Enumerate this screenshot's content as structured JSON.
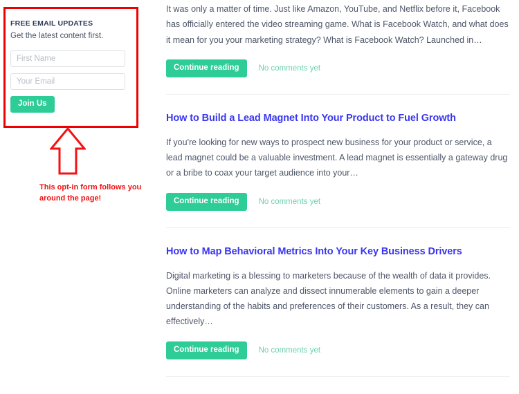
{
  "optin": {
    "heading": "FREE EMAIL UPDATES",
    "subheading": "Get the latest content first.",
    "first_name_placeholder": "First Name",
    "first_name_value": "",
    "email_placeholder": "Your Email",
    "email_value": "",
    "submit_label": "Join Us",
    "accent_color": "#2ecc96",
    "heading_color": "#2e3a59"
  },
  "annotation": {
    "text": "This opt-in form follows you around the page!",
    "color": "#f41010",
    "arrow_icon": "arrow-up-outline-icon",
    "highlight_color": "#ee0000"
  },
  "articles": [
    {
      "title": "",
      "excerpt": "It was only a matter of time. Just like Amazon, YouTube, and Netflix before it, Facebook has officially entered the video streaming game. What is Facebook Watch, and what does it mean for you your marketing strategy? What is Facebook Watch? Launched in…",
      "continue_label": "Continue reading",
      "comments_label": "No comments yet"
    },
    {
      "title": "How to Build a Lead Magnet Into Your Product to Fuel Growth",
      "excerpt": "If you're looking for new ways to prospect new business for your product or service, a lead magnet could be a valuable investment. A lead magnet is essentially a gateway drug or a bribe to coax your target audience into your…",
      "continue_label": "Continue reading",
      "comments_label": "No comments yet"
    },
    {
      "title": "How to Map Behavioral Metrics Into Your Key Business Drivers",
      "excerpt": "Digital marketing is a blessing to marketers because of the wealth of data it provides. Online marketers can analyze and dissect innumerable elements to gain a deeper understanding of the habits and preferences of their customers. As a result, they can effectively…",
      "continue_label": "Continue reading",
      "comments_label": "No comments yet"
    }
  ],
  "theme": {
    "link_color": "#3a36f0",
    "body_text_color": "#4e5668",
    "button_color": "#2ecc96",
    "comments_color": "#6ed0b0",
    "divider_color": "#eceef0"
  }
}
